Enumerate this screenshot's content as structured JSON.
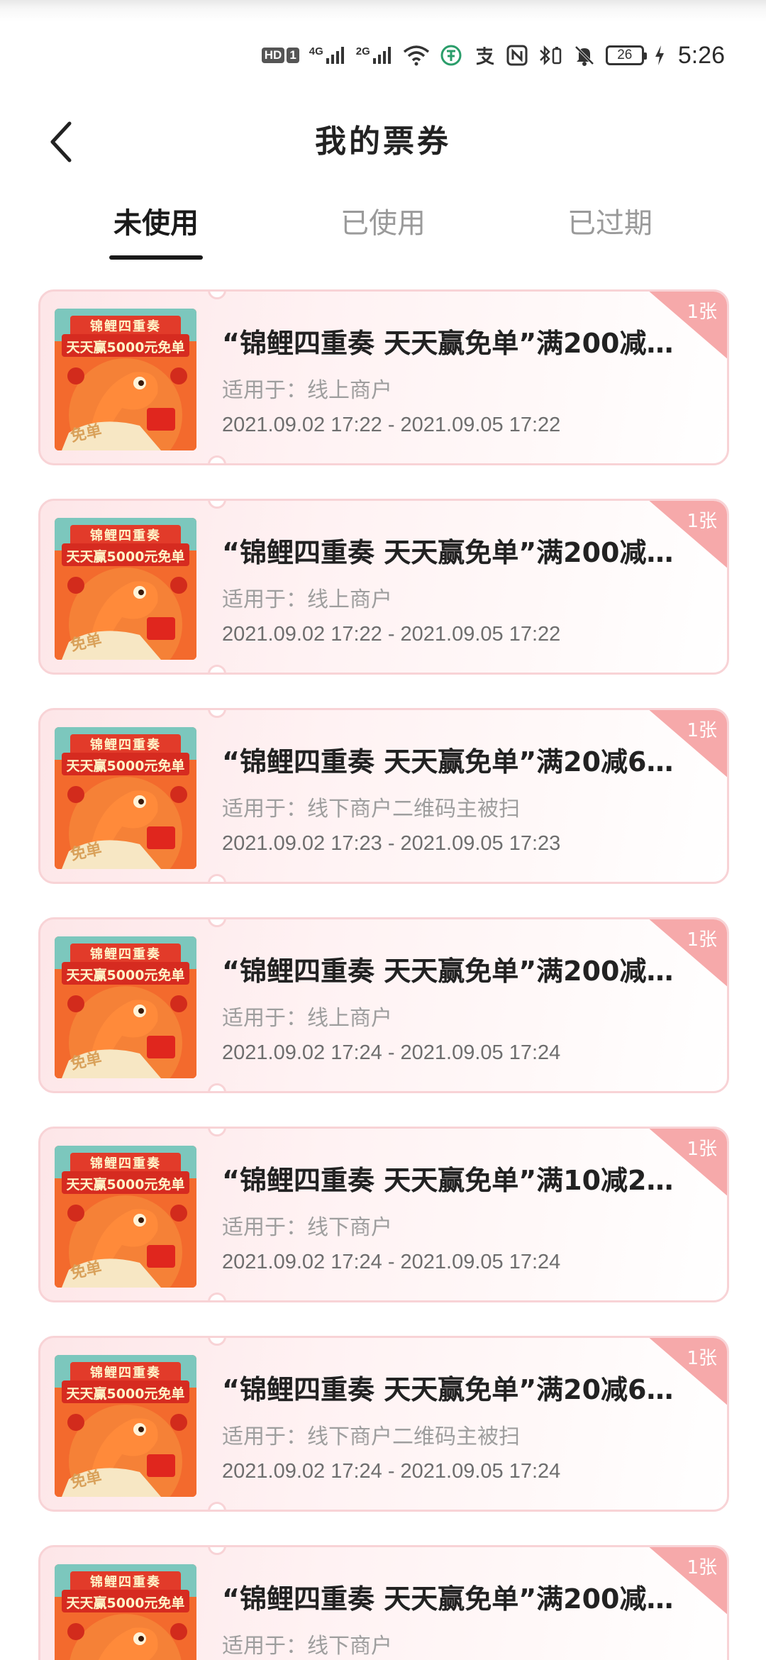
{
  "status_bar": {
    "hd_label": "HD",
    "sim_label": "1",
    "net1": "4G",
    "net2": "2G",
    "battery": "26",
    "time": "5:26"
  },
  "header": {
    "title": "我的票券"
  },
  "tabs": [
    {
      "label": "未使用",
      "active": true
    },
    {
      "label": "已使用",
      "active": false
    },
    {
      "label": "已过期",
      "active": false
    }
  ],
  "coupon_thumb": {
    "banner_top": "锦鲤四重奏",
    "banner_main": "天天赢5000元免单",
    "badge": "免单"
  },
  "coupons": [
    {
      "title": "“锦鲤四重奏 天天赢免单”满200减…",
      "scope": "适用于：线上商户",
      "date": "2021.09.02 17:22 - 2021.09.05 17:22",
      "count": "1张"
    },
    {
      "title": "“锦鲤四重奏 天天赢免单”满200减…",
      "scope": "适用于：线上商户",
      "date": "2021.09.02 17:22 - 2021.09.05 17:22",
      "count": "1张"
    },
    {
      "title": "“锦鲤四重奏 天天赢免单”满20减6…",
      "scope": "适用于：线下商户二维码主被扫",
      "date": "2021.09.02 17:23 - 2021.09.05 17:23",
      "count": "1张"
    },
    {
      "title": "“锦鲤四重奏 天天赢免单”满200减…",
      "scope": "适用于：线上商户",
      "date": "2021.09.02 17:24 - 2021.09.05 17:24",
      "count": "1张"
    },
    {
      "title": "“锦鲤四重奏 天天赢免单”满10减2…",
      "scope": "适用于：线下商户",
      "date": "2021.09.02 17:24 - 2021.09.05 17:24",
      "count": "1张"
    },
    {
      "title": "“锦鲤四重奏 天天赢免单”满20减6…",
      "scope": "适用于：线下商户二维码主被扫",
      "date": "2021.09.02 17:24 - 2021.09.05 17:24",
      "count": "1张"
    },
    {
      "title": "“锦鲤四重奏 天天赢免单”满200减…",
      "scope": "适用于：线下商户",
      "date": "",
      "count": "1张"
    }
  ]
}
